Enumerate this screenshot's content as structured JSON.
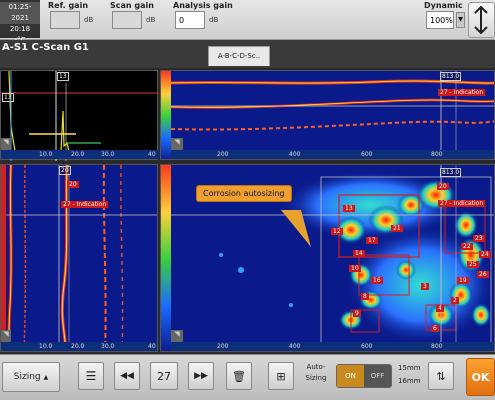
{
  "status": {
    "date": "01:25-2021",
    "time": "20:18",
    "temp": "-°C"
  },
  "gains": {
    "ref_label": "Ref. gain",
    "ref_value": "",
    "ref_unit": "dB",
    "scan_label": "Scan gain",
    "scan_value": "",
    "scan_unit": "dB",
    "analysis_label": "Analysis gain",
    "analysis_value": "0",
    "analysis_unit": "dB",
    "dynamic_label": "Dynamic",
    "dynamic_value": "100%"
  },
  "title": "A-S1 C-Scan G1",
  "tab_label": "A-B-C-D-Sc..",
  "ascan": {
    "ticks": [
      "10.0",
      "20.0",
      "30.0",
      "40"
    ],
    "gate_a": "13",
    "gate_b": "13"
  },
  "bscan_top": {
    "ticks": [
      "200",
      "400",
      "600",
      "800"
    ],
    "gate_label": "813.0",
    "indication": "27 - Indication"
  },
  "bscan_left": {
    "ticks": [
      "10.0",
      "20.0",
      "30.0",
      "40"
    ],
    "indication": "27 - Indication",
    "marker_top": "20",
    "marker": "20"
  },
  "cscan": {
    "ticks": [
      "200",
      "400",
      "600",
      "800"
    ],
    "callout": "Corrosion autosizing",
    "gate_label": "813.0",
    "indication": "27 - Indication",
    "marker_top": "20",
    "indications": [
      "12",
      "13",
      "21",
      "17",
      "14",
      "10",
      "16",
      "8",
      "9",
      "3",
      "4",
      "2",
      "6",
      "23",
      "22",
      "24",
      "25",
      "26",
      "19"
    ]
  },
  "bottom": {
    "sizing_label": "Sizing",
    "index_value": "27",
    "auto_sizing_label": "Auto-\nSizing",
    "on": "ON",
    "off": "OFF",
    "size1": "15mm",
    "size2": "16mm",
    "ok": "OK"
  }
}
